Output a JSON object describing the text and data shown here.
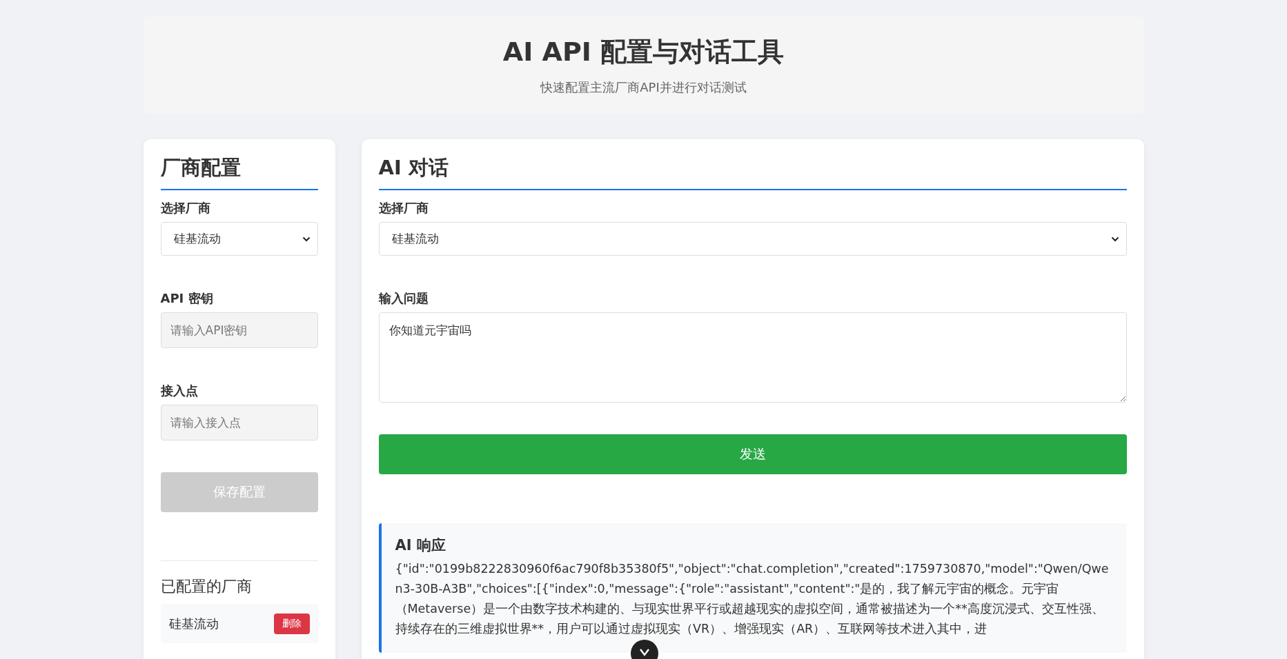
{
  "header": {
    "title": "AI API 配置与对话工具",
    "subtitle": "快速配置主流厂商API并进行对话测试"
  },
  "config_panel": {
    "title": "厂商配置",
    "vendor_label": "选择厂商",
    "vendor_value": "硅基流动",
    "api_key_label": "API 密钥",
    "api_key_placeholder": "请输入API密钥",
    "endpoint_label": "接入点",
    "endpoint_placeholder": "请输入接入点",
    "save_button": {
      "label": "保存配置",
      "disabled": true
    },
    "configured_title": "已配置的厂商",
    "configured_vendors": [
      {
        "name": "硅基流动",
        "delete_label": "删除"
      }
    ]
  },
  "chat_panel": {
    "title": "AI 对话",
    "vendor_label": "选择厂商",
    "vendor_value": "硅基流动",
    "question_label": "输入问题",
    "question_value": "你知道元宇宙吗",
    "send_button": {
      "label": "发送",
      "disabled": false
    },
    "response": {
      "title": "AI 响应",
      "text": "{\"id\":\"0199b8222830960f6ac790f8b35380f5\",\"object\":\"chat.completion\",\"created\":1759730870,\"model\":\"Qwen/Qwen3-30B-A3B\",\"choices\":[{\"index\":0,\"message\":{\"role\":\"assistant\",\"content\":\"是的，我了解元宇宙的概念。元宇宙（Metaverse）是一个由数字技术构建的、与现实世界平行或超越现实的虚拟空间，通常被描述为一个**高度沉浸式、交互性强、持续存在的三维虚拟世界**，用户可以通过虚拟现实（VR）、增强现实（AR）、互联网等技术进入其中，进"
    }
  }
}
